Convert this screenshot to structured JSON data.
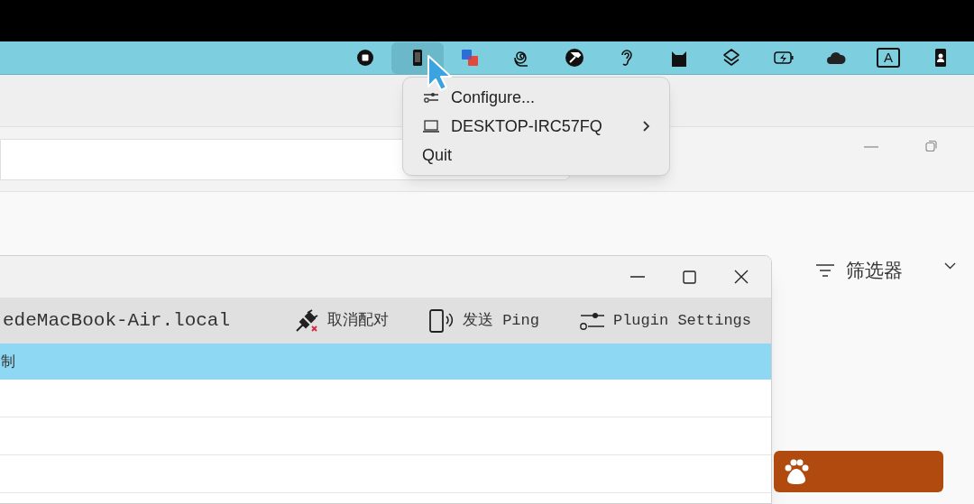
{
  "menu_bar": {
    "items": [
      {
        "kind": "stop",
        "selected": false
      },
      {
        "kind": "phone",
        "selected": true
      },
      {
        "kind": "squares",
        "selected": false
      },
      {
        "kind": "spiral",
        "selected": false
      },
      {
        "kind": "hammer",
        "selected": false
      },
      {
        "kind": "ear",
        "selected": false
      },
      {
        "kind": "cat",
        "selected": false
      },
      {
        "kind": "layers",
        "selected": false
      },
      {
        "kind": "battery",
        "selected": false
      },
      {
        "kind": "cloud",
        "selected": false
      },
      {
        "kind": "input",
        "label": "A",
        "selected": false
      },
      {
        "kind": "card",
        "selected": false
      }
    ]
  },
  "dropdown_menu": {
    "items": [
      {
        "kind": "settings",
        "label": "Configure...",
        "submenu": false
      },
      {
        "kind": "device",
        "label": "DESKTOP-IRC57FQ",
        "submenu": true
      },
      {
        "kind": "plain",
        "label": "Quit",
        "submenu": false
      }
    ]
  },
  "background_window": {
    "filter": {
      "label": "筛选器"
    }
  },
  "device_window": {
    "device_name": "edeMacBook-Air.local",
    "actions": [
      {
        "kind": "unpair",
        "label": "取消配对"
      },
      {
        "kind": "ping",
        "label": "发送 Ping"
      },
      {
        "kind": "settings",
        "label": "Plugin Settings"
      }
    ],
    "list": {
      "items": [
        {
          "label": "制",
          "selected": true
        }
      ]
    }
  }
}
